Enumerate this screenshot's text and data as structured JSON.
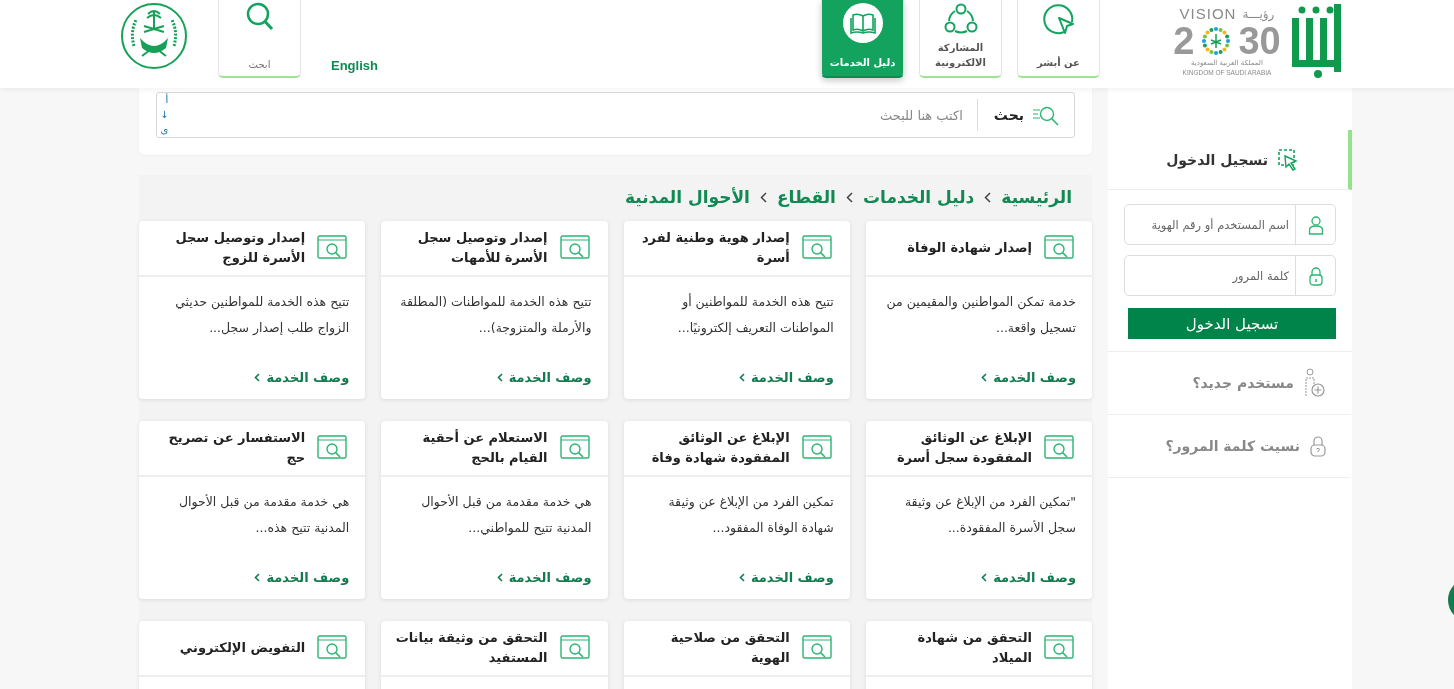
{
  "header": {
    "nav": [
      {
        "label": "عن أبشر",
        "selected": false
      },
      {
        "label": "المشاركة الالكترونية",
        "selected": false
      },
      {
        "label": "دليل الخدمات",
        "selected": true
      }
    ],
    "language": "English",
    "search_tab": "ابحث",
    "vision_logo": {
      "word": "VISION",
      "arabic": "رؤيـــة",
      "year_start": "2",
      "year_end": "30",
      "country_ar": "المملكة العربية السعودية",
      "country_en": "KINGDOM OF SAUDI ARABIA"
    }
  },
  "search": {
    "button": "بحث",
    "placeholder": "اكتب هنا للبحث",
    "side_marks": [
      "أ",
      "↓",
      "ى"
    ]
  },
  "breadcrumb": [
    "الرئيسية",
    "دليل الخدمات",
    "القطاع",
    "الأحوال المدنية"
  ],
  "services": [
    {
      "title": "إصدار شهادة الوفاة",
      "description": "خدمة تمكن المواطنين والمقيمين من تسجيل واقعة...",
      "link": "وصف الخدمة"
    },
    {
      "title": "إصدار هوية وطنية لفرد أسرة",
      "description": "تتيح هذه الخدمة للمواطنين أو المواطنات التعريف إلكترونيًا...",
      "link": "وصف الخدمة"
    },
    {
      "title": "إصدار وتوصيل سجل الأسرة للأمهات",
      "description": "تتيح هذه الخدمة للمواطنات (المطلقة والأرملة والمتزوجة)...",
      "link": "وصف الخدمة"
    },
    {
      "title": "إصدار وتوصيل سجل الأسرة للزوج",
      "description": "تتيح هذه الخدمة للمواطنين حديثي الزواج طلب إصدار سجل...",
      "link": "وصف الخدمة"
    },
    {
      "title": "الإبلاغ عن الوثائق المفقودة سجل أسرة",
      "description": "\"تمكين الفرد من الإبلاغ عن وثيقة سجل الأسرة المفقودة...",
      "link": "وصف الخدمة"
    },
    {
      "title": "الإبلاغ عن الوثائق المفقودة شهادة وفاة",
      "description": "تمكين الفرد من الإبلاغ عن وثيقة شهادة الوفاة المفقود...",
      "link": "وصف الخدمة"
    },
    {
      "title": "الاستعلام عن أحقية القيام بالحج",
      "description": "هي خدمة مقدمة من قبل الأحوال المدنية تتيح للمواطني...",
      "link": "وصف الخدمة"
    },
    {
      "title": "الاستفسار عن تصريح حج",
      "description": "هي خدمة مقدمة من قبل الأحوال المدنية تتيح هذه...",
      "link": "وصف الخدمة"
    },
    {
      "title": "التحقق من شهادة الميلاد"
    },
    {
      "title": "التحقق من صلاحية الهوية"
    },
    {
      "title": "التحقق من وثيقة بيانات المستفيد"
    },
    {
      "title": "التفويض الإلكتروني"
    }
  ],
  "sidebar": {
    "items": [
      {
        "label": "تسجيل الدخول",
        "selected": true
      },
      {
        "label": "مستخدم جديد؟",
        "selected": false
      },
      {
        "label": "نسيت كلمة المرور؟",
        "selected": false
      }
    ],
    "login_form": {
      "username_placeholder": "اسم المستخدم أو رقم الهوية",
      "password_placeholder": "كلمة المرور",
      "submit": "تسجيل الدخول"
    }
  }
}
